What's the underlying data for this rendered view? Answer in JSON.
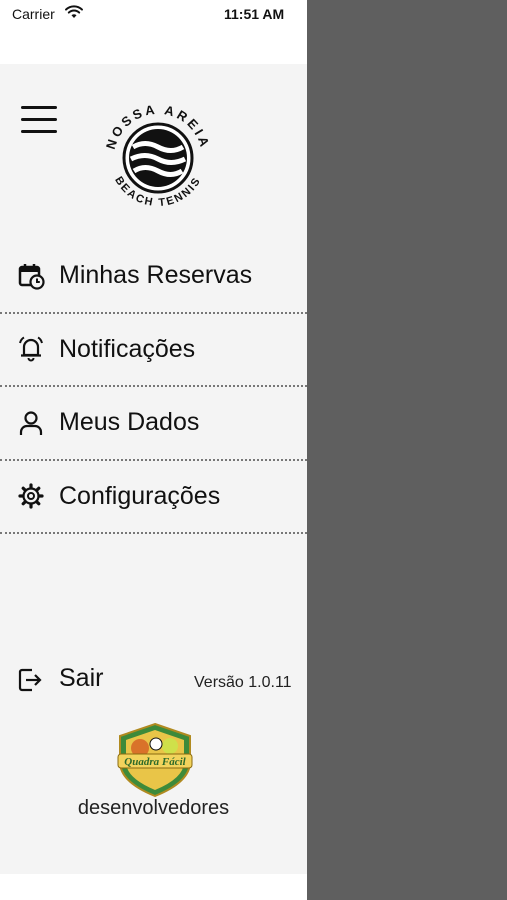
{
  "status": {
    "carrier": "Carrier",
    "time": "11:51 AM"
  },
  "logo": {
    "top_text": "NOSSA AREIA",
    "bottom_text": "BEACH TENNIS"
  },
  "menu": {
    "items": [
      {
        "label": "Minhas Reservas",
        "icon": "calendar-clock-icon"
      },
      {
        "label": "Notificações",
        "icon": "bell-icon"
      },
      {
        "label": "Meus Dados",
        "icon": "user-icon"
      },
      {
        "label": "Configurações",
        "icon": "gear-icon"
      }
    ]
  },
  "footer": {
    "logout_label": "Sair",
    "version": "Versão 1.0.11",
    "developer_badge": "Quadra Fácil",
    "developer_label": "desenvolvedores"
  },
  "colors": {
    "overlay": "#5f5f5f",
    "drawer": "#f4f4f4",
    "text": "#111111",
    "badge_gold": "#e9c548",
    "badge_green": "#3d8a3a"
  }
}
